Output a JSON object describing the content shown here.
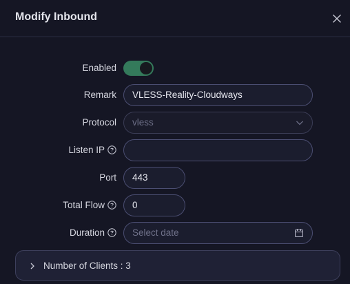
{
  "dialog": {
    "title": "Modify Inbound",
    "close_icon": "close-icon"
  },
  "form": {
    "enabled": {
      "label": "Enabled",
      "value": true
    },
    "remark": {
      "label": "Remark",
      "value": "VLESS-Reality-Cloudways"
    },
    "protocol": {
      "label": "Protocol",
      "value": "vless",
      "disabled": true
    },
    "listen_ip": {
      "label": "Listen IP",
      "value": "",
      "help_icon": "question-circle-icon"
    },
    "port": {
      "label": "Port",
      "value": "443"
    },
    "total_flow": {
      "label": "Total Flow",
      "value": "0",
      "help_icon": "question-circle-icon"
    },
    "duration": {
      "label": "Duration",
      "placeholder": "Select date",
      "help_icon": "question-circle-icon",
      "calendar_icon": "calendar-icon"
    }
  },
  "clients": {
    "label": "Number of Clients : 3",
    "expanded": false
  },
  "colors": {
    "background": "#151624",
    "toggle_on": "#347a5b",
    "input_border": "#4b4e72"
  }
}
